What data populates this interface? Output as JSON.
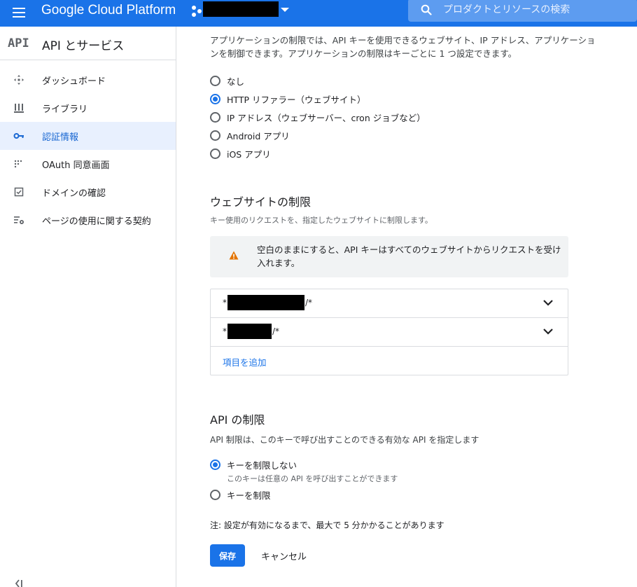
{
  "topbar": {
    "app_title": "Google Cloud Platform",
    "search_placeholder": "プロダクトとリソースの検索",
    "accent_color": "#1a73e8"
  },
  "sidebar": {
    "logo_text": "API",
    "title": "API とサービス",
    "items": [
      {
        "label": "ダッシュボード",
        "icon": "dashboard-icon",
        "active": false
      },
      {
        "label": "ライブラリ",
        "icon": "library-icon",
        "active": false
      },
      {
        "label": "認証情報",
        "icon": "key-icon",
        "active": true
      },
      {
        "label": "OAuth 同意画面",
        "icon": "consent-icon",
        "active": false
      },
      {
        "label": "ドメインの確認",
        "icon": "domain-check-icon",
        "active": false
      },
      {
        "label": "ページの使用に関する契約",
        "icon": "settings-list-icon",
        "active": false
      }
    ]
  },
  "app_restrictions": {
    "intro": "アプリケーションの制限では、API キーを使用できるウェブサイト、IP アドレス、アプリケーションを制御できます。アプリケーションの制限はキーごとに 1 つ設定できます。",
    "options": [
      {
        "label": "なし",
        "checked": false
      },
      {
        "label": "HTTP リファラー（ウェブサイト）",
        "checked": true
      },
      {
        "label": "IP アドレス（ウェブサーバー、cron ジョブなど）",
        "checked": false
      },
      {
        "label": "Android アプリ",
        "checked": false
      },
      {
        "label": "iOS アプリ",
        "checked": false
      }
    ]
  },
  "website_restrictions": {
    "title": "ウェブサイトの制限",
    "description": "キー使用のリクエストを、指定したウェブサイトに制限します。",
    "warning": "空白のままにすると、API キーはすべてのウェブサイトからリクエストを受け入れます。",
    "referrers": [
      {
        "prefix": "*",
        "suffix": "/*"
      },
      {
        "prefix": "*",
        "suffix": "/*"
      }
    ],
    "add_item_label": "項目を追加"
  },
  "api_restrictions": {
    "title": "API の制限",
    "description": "API 制限は、このキーで呼び出すことのできる有効な API を指定します",
    "options": [
      {
        "label": "キーを制限しない",
        "description": "このキーは任意の API を呼び出すことができます",
        "checked": true
      },
      {
        "label": "キーを制限",
        "checked": false
      }
    ]
  },
  "footer": {
    "note": "注: 設定が有効になるまで、最大で 5 分かかることがあります",
    "save_label": "保存",
    "cancel_label": "キャンセル"
  }
}
